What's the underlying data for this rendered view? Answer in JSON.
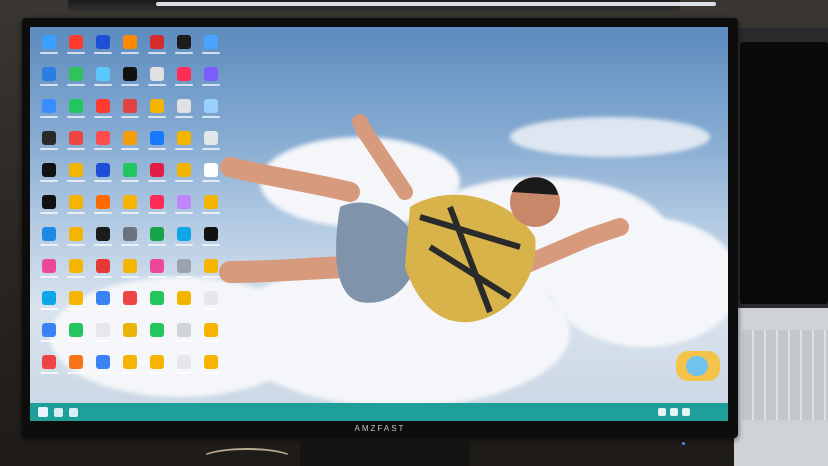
{
  "monitor": {
    "brand": "AMZFAST"
  },
  "desktop": {
    "icon_colors": [
      "#3aa0ff",
      "#ff3b30",
      "#1d4fd6",
      "#ff8a00",
      "#d62b2b",
      "#1b1b1b",
      "#4aa3ff",
      "#2a7de1",
      "#2ec45a",
      "#5ac8fa",
      "#111111",
      "#e0e0e0",
      "#ff2d55",
      "#7d5cff",
      "#3b8cff",
      "#22c55e",
      "#ff3b30",
      "#e24141",
      "#f5b400",
      "#e2e2e2",
      "#9ad0ff",
      "#2a2a2a",
      "#ef4444",
      "#ff4d4f",
      "#f59e0b",
      "#1677ff",
      "#f5b400",
      "#e5e7eb",
      "#111111",
      "#f5b400",
      "#1d4ed8",
      "#22c55e",
      "#e11d48",
      "#f5b400",
      "#ffffff",
      "#111111",
      "#f5b400",
      "#ff6a00",
      "#f5b400",
      "#ff2d55",
      "#c084fc",
      "#f5b400",
      "#1e88e5",
      "#f5b400",
      "#1b1b1b",
      "#6b7280",
      "#16a34a",
      "#0ea5e9",
      "#111111",
      "#ec4899",
      "#f5b400",
      "#e53935",
      "#f5b400",
      "#ec4899",
      "#9ca3af",
      "#f5b400",
      "#0ea5e9",
      "#f5b400",
      "#3b82f6",
      "#ef4444",
      "#22c55e",
      "#f5b400",
      "#e5e7eb",
      "#3b82f6",
      "#22c55e",
      "#e5e7eb",
      "#eab308",
      "#22c55e",
      "#d1d5db",
      "#f5b400",
      "#ef4444",
      "#f97316",
      "#3b82f6",
      "#f5b400",
      "#f5b400",
      "#e5e7eb",
      "#f5b400"
    ]
  }
}
